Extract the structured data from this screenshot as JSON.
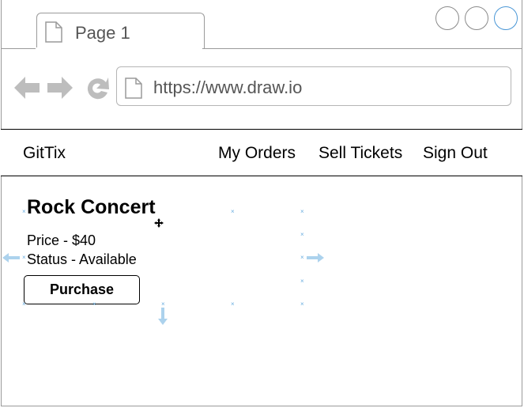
{
  "browser": {
    "tab_label": "Page 1",
    "url": "https://www.draw.io",
    "window_buttons": [
      "minimize-button",
      "maximize-button",
      "close-button"
    ]
  },
  "nav": {
    "brand": "GitTix",
    "links": [
      "My Orders",
      "Sell Tickets",
      "Sign Out"
    ]
  },
  "ticket": {
    "title": "Rock Concert",
    "price": "Price - $40",
    "status": "Status - Available",
    "purchase_label": "Purchase"
  },
  "colors": {
    "accent": "#4a97d6",
    "border": "#9a9a9a",
    "guide": "#6aaee0"
  },
  "icons": {
    "back": "arrow-left-icon",
    "forward": "arrow-right-icon",
    "reload": "reload-icon",
    "page": "page-icon",
    "move": "move-cursor-icon"
  }
}
